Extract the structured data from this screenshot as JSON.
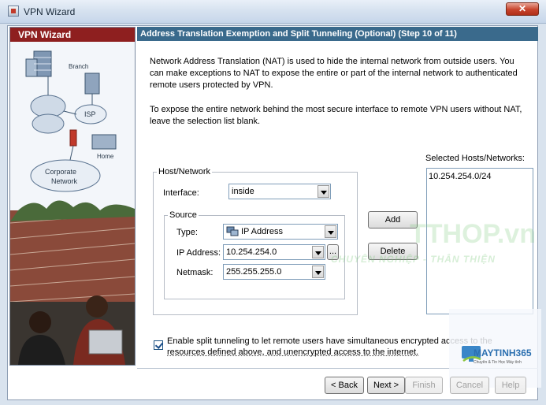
{
  "window": {
    "title": "VPN Wizard",
    "close_glyph": "✕"
  },
  "sidebar": {
    "title": "VPN Wizard",
    "art_labels": {
      "branch": "Branch",
      "isp": "ISP",
      "home": "Home",
      "corporate": "Corporate\nNetwork"
    }
  },
  "header": {
    "step_title": "Address Translation Exemption and Split Tunneling (Optional)  (Step 10 of 11)"
  },
  "intro": {
    "p1": "Network Address Translation (NAT) is used to hide the internal network from outside users. You can make exceptions to NAT to expose the entire or part of the internal network to authenticated remote users protected by VPN.",
    "p2": "To expose the entire network behind the most secure interface to remote VPN users without NAT, leave the selection list blank."
  },
  "host_network": {
    "legend": "Host/Network",
    "interface_label": "Interface:",
    "interface_value": "inside",
    "source": {
      "legend": "Source",
      "type_label": "Type:",
      "type_value": "IP Address",
      "ip_label": "IP Address:",
      "ip_value": "10.254.254.0",
      "browse_label": "...",
      "netmask_label": "Netmask:",
      "netmask_value": "255.255.255.0"
    }
  },
  "actions": {
    "add": "Add",
    "delete": "Delete"
  },
  "selected": {
    "label": "Selected Hosts/Networks:",
    "items": [
      "10.254.254.0/24"
    ]
  },
  "split_tunnel": {
    "checked": true,
    "line1": "Enable split tunneling to let remote users have simultaneous encrypted access to the",
    "line2": "resources defined above, and unencrypted access to the internet."
  },
  "footer": {
    "back": "< Back",
    "next": "Next >",
    "finish": "Finish",
    "cancel": "Cancel",
    "help": "Help"
  },
  "watermark": {
    "main": "TTHOP.vn",
    "sub": "CHUYÊN NGHIỆP - THÂN THIỆN",
    "logo": "MAYTINH365",
    "logo_tag": "Chuyên & Tin Học Máy tính"
  },
  "colors": {
    "sidebar_header": "#8e1f1f",
    "step_header": "#3a6a8c"
  }
}
